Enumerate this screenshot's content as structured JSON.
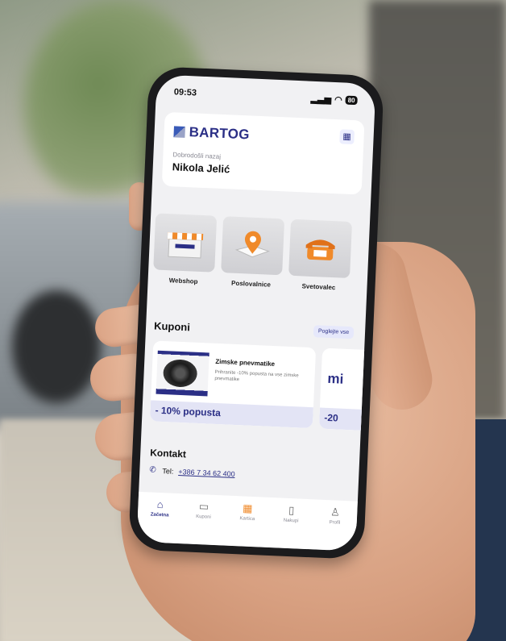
{
  "status_bar": {
    "time": "09:53",
    "battery": "80"
  },
  "header": {
    "brand": "BARTOG",
    "welcome_label": "Dobrodošli nazaj",
    "user_name": "Nikola Jelić"
  },
  "shortcuts": [
    {
      "label": "Webshop",
      "icon": "shop-awning-icon"
    },
    {
      "label": "Poslovalnice",
      "icon": "map-pin-icon"
    },
    {
      "label": "Svetovalec",
      "icon": "telephone-icon"
    }
  ],
  "coupons": {
    "title": "Kuponi",
    "see_all": "Poglejte vse",
    "items": [
      {
        "title": "Zimske pnevmatike",
        "description": "Prihranite -10% popusta na vse zimske pnevmatike",
        "discount": "- 10% popusta"
      },
      {
        "logo_text": "mi",
        "discount": "-20"
      }
    ]
  },
  "contact": {
    "title": "Kontakt",
    "tel_label": "Tel:",
    "tel_number": "+386 7 34 62 400"
  },
  "tabbar": [
    {
      "label": "Začetna",
      "icon": "home-icon"
    },
    {
      "label": "Kuponi",
      "icon": "ticket-icon"
    },
    {
      "label": "Kartica",
      "icon": "qr-card-icon"
    },
    {
      "label": "Nakupi",
      "icon": "receipt-icon"
    },
    {
      "label": "Profil",
      "icon": "user-icon"
    }
  ],
  "colors": {
    "brand": "#2b2f86",
    "accent": "#f08a2a"
  }
}
